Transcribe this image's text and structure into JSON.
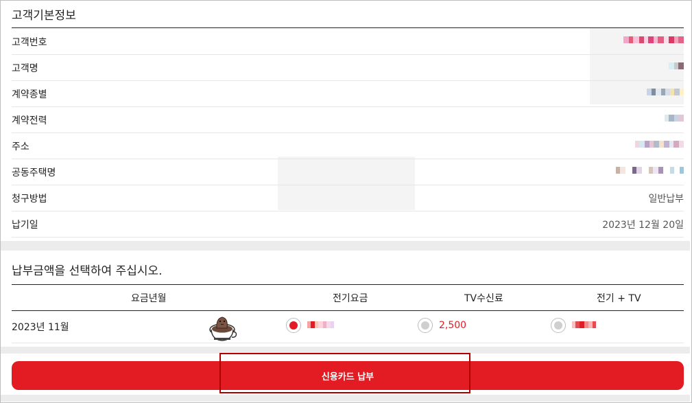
{
  "customer_info": {
    "title": "고객기본정보",
    "rows": [
      {
        "label": "고객번호",
        "value": ""
      },
      {
        "label": "고객명",
        "value": ""
      },
      {
        "label": "계약종별",
        "value": ""
      },
      {
        "label": "계약전력",
        "value": ""
      },
      {
        "label": "주소",
        "value": ""
      },
      {
        "label": "공동주택명",
        "value": ""
      },
      {
        "label": "청구방법",
        "value": "일반납부"
      },
      {
        "label": "납기일",
        "value": "2023년 12월 20일"
      }
    ]
  },
  "payment_select": {
    "title": "납부금액을 선택하여 주십시오.",
    "headers": {
      "billing_month": "요금년월",
      "electric": "전기요금",
      "tv": "TV수신료",
      "combined": "전기 + TV"
    },
    "row": {
      "billing_month": "2023년 11월",
      "electric_amount": "",
      "tv_amount": "2,500",
      "combined_amount": "",
      "selected": "electric"
    },
    "logo_icon": "coffee-cup-mascot-icon"
  },
  "actions": {
    "pay_label": "신용카드 납부"
  },
  "colors": {
    "accent": "#e31c23",
    "highlight_border": "#b00000"
  }
}
